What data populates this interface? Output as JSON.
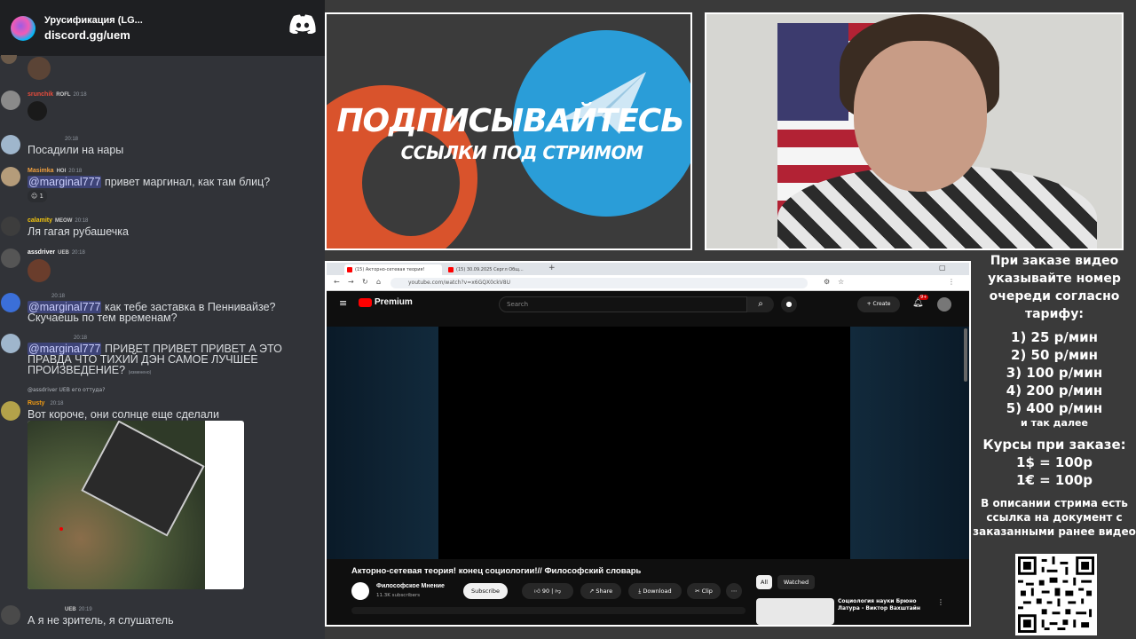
{
  "discord": {
    "server_name": "Урусификация (LG...",
    "invite": "discord.gg/uem"
  },
  "messages": [
    {
      "user": "srunchik",
      "badge": "ROFL",
      "time": "20:18",
      "text": ""
    },
    {
      "user": "",
      "badge": "",
      "time": "20:18",
      "text": "Посадили на нары"
    },
    {
      "user": "Masimka",
      "badge": "HOI",
      "time": "20:18",
      "mention": "@marginal777",
      "text": " привет маргинал, как там блиц?",
      "reaction_count": "1"
    },
    {
      "user": "calamity",
      "badge": "MEOW",
      "time": "20:18",
      "text": "Ля гагая рубашечка"
    },
    {
      "user": "assdriver",
      "badge": "UEB",
      "time": "20:18",
      "text": ""
    },
    {
      "user": "",
      "badge": "",
      "time": "20:18",
      "mention": "@marginal777",
      "text": " как тебе заставка в Пеннивайзе? Скучаешь по тем временам?"
    },
    {
      "user": "",
      "badge": "",
      "time": "20:18",
      "mention": "@marginal777",
      "text": " ПРИВЕТ ПРИВЕТ ПРИВЕТ А ЭТО ПРАВДА ЧТО ТИХИЙ ДЭН САМОЕ ЛУЧШЕЕ ПРОИЗВЕДЕНИЕ?",
      "edited": "(изменено)"
    },
    {
      "reply_user": "@assdriver",
      "reply_badge": "UEB",
      "reply_text": "его оттуда?",
      "user": "Rusty",
      "badge": "",
      "time": "20:18",
      "text": "Вот короче, они солнце еще сделали"
    },
    {
      "user": "",
      "badge": "UEB",
      "time": "20:19",
      "text": "А я не зритель, я слушатель"
    }
  ],
  "promo": {
    "title": "ПОДПИСЫВАЙТЕСЬ",
    "subtitle": "ССЫЛКИ ПОД СТРИМОМ"
  },
  "browser": {
    "tab1": "(15) Акторно-сетевая теория!",
    "tab2": "(15) 30.09.2025 Сергл Общ...",
    "url": "youtube.com/watch?v=x6GQX0ckV8U",
    "yt_brand": "Premium",
    "search_placeholder": "Search",
    "create": "Create",
    "notif": "9+",
    "video_title": "Акторно-сетевая теория! конец социологии!// Философский словарь",
    "channel": "Философское Мнение",
    "subs": "11.3K subscribers",
    "subscribe": "Subscribe",
    "likes": "90",
    "share": "Share",
    "download": "Download",
    "clip": "Clip",
    "chip_all": "All",
    "chip_watched": "Watched",
    "rec_title": "Социология науки Брюно Латура - Виктор Вахштайн"
  },
  "info": {
    "l1": "При заказе видео указывайте номер очереди согласно тарифу:",
    "t1": "1) 25 р/мин",
    "t2": "2) 50 р/мин",
    "t3": "3) 100 р/мин",
    "t4": "4) 200 р/мин",
    "t5": "5) 400 р/мин",
    "etc": "и так далее",
    "rates_title": "Курсы при заказе:",
    "r1": "1$ = 100р",
    "r2": "1€ = 100р",
    "desc": "В описании стрима есть ссылка на документ с заказанными ранее видео"
  }
}
